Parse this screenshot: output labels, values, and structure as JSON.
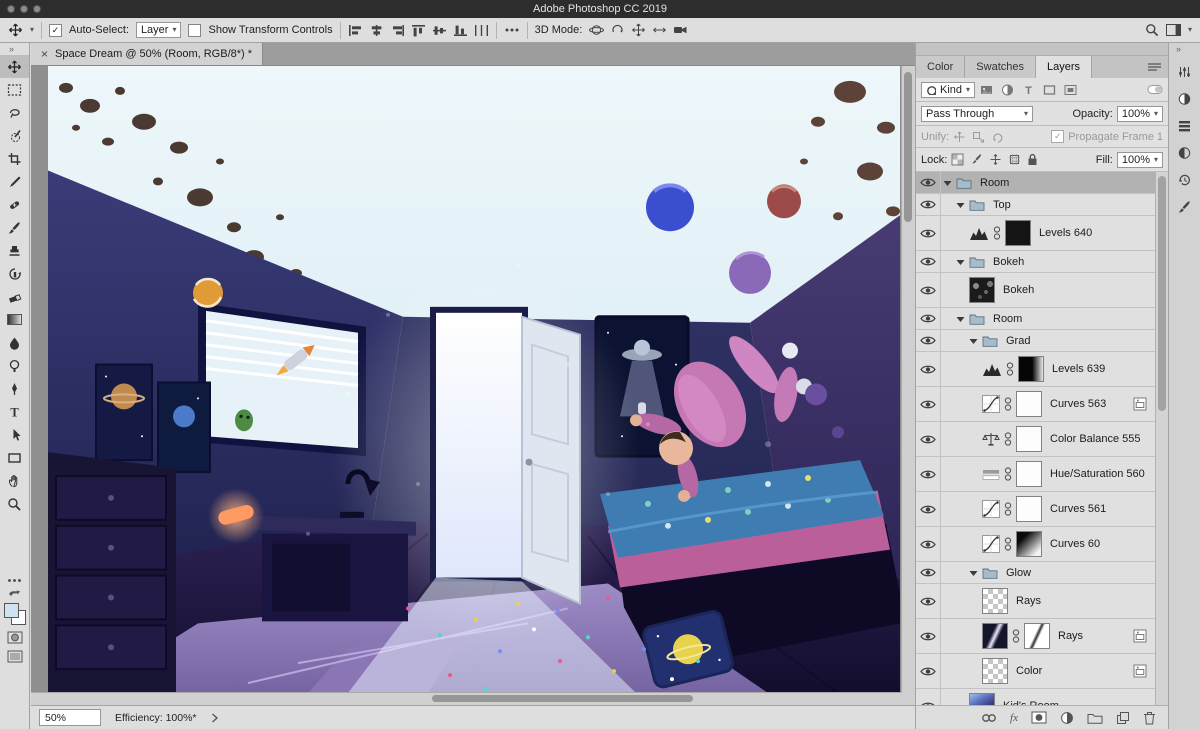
{
  "window": {
    "title": "Adobe Photoshop CC 2019"
  },
  "options_bar": {
    "auto_select_label": "Auto-Select:",
    "auto_select_value": "Layer",
    "show_transform_label": "Show Transform Controls",
    "mode_label": "3D Mode:",
    "align_icons": [
      "align-left-icon",
      "align-center-h-icon",
      "align-right-icon",
      "align-top-icon",
      "align-middle-icon",
      "align-bottom-icon",
      "distribute-h-icon"
    ],
    "mode_icons": [
      "orbit-3d-icon",
      "roll-3d-icon",
      "pan-3d-icon",
      "slide-3d-icon",
      "dolly-3d-icon"
    ]
  },
  "document_tab": {
    "close": "×",
    "title": "Space Dream @ 50% (Room, RGB/8*) *"
  },
  "toolbar": {
    "collapse": "»",
    "foreground_color": "#cfe2ee",
    "background_color": "#ffffff",
    "tools": [
      {
        "name": "move-tool",
        "selected": true
      },
      {
        "name": "rectangular-marquee-tool"
      },
      {
        "name": "lasso-tool"
      },
      {
        "name": "quick-selection-tool"
      },
      {
        "name": "crop-tool"
      },
      {
        "name": "eyedropper-tool"
      },
      {
        "name": "healing-brush-tool"
      },
      {
        "name": "brush-tool"
      },
      {
        "name": "clone-stamp-tool"
      },
      {
        "name": "history-brush-tool"
      },
      {
        "name": "eraser-tool"
      },
      {
        "name": "gradient-tool"
      },
      {
        "name": "blur-tool"
      },
      {
        "name": "dodge-tool"
      },
      {
        "name": "pen-tool"
      },
      {
        "name": "type-tool"
      },
      {
        "name": "path-selection-tool"
      },
      {
        "name": "rectangle-tool"
      },
      {
        "name": "hand-tool"
      },
      {
        "name": "zoom-tool"
      }
    ]
  },
  "layers_panel": {
    "tabs": [
      "Color",
      "Swatches",
      "Layers"
    ],
    "active_tab": "Layers",
    "kind_label": "Kind",
    "filter_icons": [
      "filter-pixel-icon",
      "filter-adjustment-icon",
      "filter-type-icon",
      "filter-shape-icon",
      "filter-smart-icon"
    ],
    "blend_mode": "Pass Through",
    "opacity_label": "Opacity:",
    "opacity_value": "100%",
    "unify_label": "Unify:",
    "unify_icons": [
      "unify-position-icon",
      "unify-scale-icon",
      "unify-rotate-icon"
    ],
    "propagate_label": "Propagate Frame 1",
    "lock_label": "Lock:",
    "lock_icons": [
      "lock-transparent-icon",
      "lock-paint-icon",
      "lock-position-icon",
      "lock-artboard-icon",
      "lock-all-icon"
    ],
    "fill_label": "Fill:",
    "fill_value": "100%",
    "layers": [
      {
        "name": "Room",
        "kind": "group",
        "indent": 0,
        "expanded": true,
        "selected": true
      },
      {
        "name": "Top",
        "kind": "group",
        "indent": 1,
        "expanded": true
      },
      {
        "name": "Levels 640",
        "kind": "adjustment",
        "indent": 2,
        "icon": "adj-levels-icon",
        "linked": true,
        "mask": "black"
      },
      {
        "name": "Bokeh",
        "kind": "group",
        "indent": 1,
        "expanded": true
      },
      {
        "name": "Bokeh",
        "kind": "layer",
        "indent": 2,
        "thumb": "bokeh"
      },
      {
        "name": "Room",
        "kind": "group",
        "indent": 1,
        "expanded": true
      },
      {
        "name": "Grad",
        "kind": "group",
        "indent": 2,
        "expanded": true
      },
      {
        "name": "Levels 639",
        "kind": "adjustment",
        "indent": 3,
        "icon": "adj-levels-icon",
        "linked": true,
        "mask": "grad-dark"
      },
      {
        "name": "Curves 563",
        "kind": "adjustment",
        "indent": 3,
        "icon": "adj-curves-icon",
        "linked": true,
        "mask": "white",
        "badge": true
      },
      {
        "name": "Color Balance 555",
        "kind": "adjustment",
        "indent": 3,
        "icon": "adj-color-balance-icon",
        "linked": true,
        "mask": "white"
      },
      {
        "name": "Hue/Saturation 560",
        "kind": "adjustment",
        "indent": 3,
        "icon": "adj-hue-sat-icon",
        "linked": true,
        "mask": "white"
      },
      {
        "name": "Curves 561",
        "kind": "adjustment",
        "indent": 3,
        "icon": "adj-curves-icon",
        "linked": true,
        "mask": "white"
      },
      {
        "name": "Curves 60",
        "kind": "adjustment",
        "indent": 3,
        "icon": "adj-curves-icon",
        "linked": true,
        "mask": "grad"
      },
      {
        "name": "Glow",
        "kind": "group",
        "indent": 2,
        "expanded": true
      },
      {
        "name": "Rays",
        "kind": "layer",
        "indent": 3,
        "thumb": "checker"
      },
      {
        "name": "Rays",
        "kind": "layer",
        "indent": 3,
        "thumb": "rays",
        "linked": true,
        "mask": "rays-mask",
        "badge": true
      },
      {
        "name": "Color",
        "kind": "layer",
        "indent": 3,
        "thumb": "checker",
        "badge": true
      },
      {
        "name": "Kid's Room",
        "kind": "layer",
        "indent": 2,
        "thumb": "room"
      }
    ],
    "footer_icons": [
      "link-layers-icon",
      "layer-effects-icon",
      "add-mask-icon",
      "new-adjustment-icon",
      "new-group-icon",
      "new-layer-icon",
      "delete-layer-icon"
    ]
  },
  "status_bar": {
    "zoom": "50%",
    "efficiency": "Efficiency: 100%*"
  },
  "dock": {
    "collapse": "»",
    "icons": [
      "properties-panel-icon",
      "adjustments-panel-icon",
      "libraries-panel-icon",
      "color-panel-icon",
      "history-panel-icon",
      "brushes-panel-icon"
    ]
  }
}
